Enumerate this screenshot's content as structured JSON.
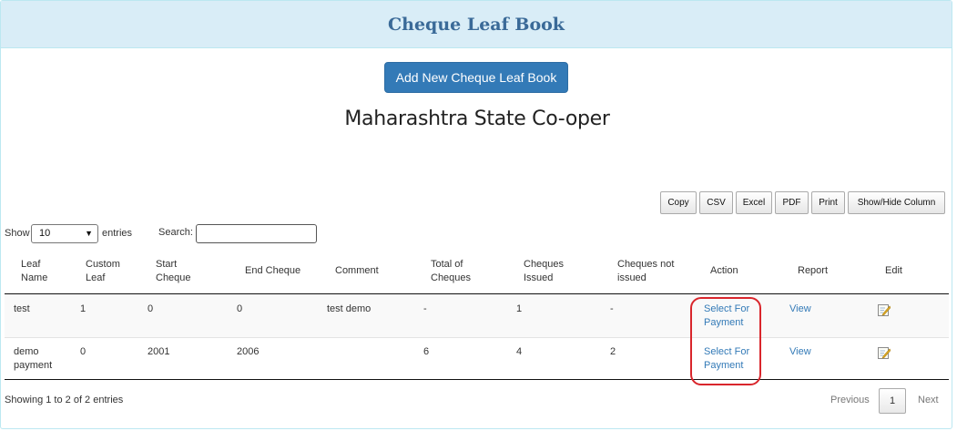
{
  "panel": {
    "title": "Cheque Leaf Book"
  },
  "add_button": {
    "label": "Add New Cheque Leaf Book"
  },
  "bank_name": "Maharashtra State Co-oper",
  "export_buttons": {
    "copy": "Copy",
    "csv": "CSV",
    "excel": "Excel",
    "pdf": "PDF",
    "print": "Print",
    "show_hide": "Show/Hide Column"
  },
  "length_control": {
    "show_label": "Show",
    "selected": "10",
    "entries_label": "entries"
  },
  "search": {
    "label": "Search:",
    "value": ""
  },
  "table": {
    "headers": {
      "leaf_name": [
        "Leaf",
        "Name"
      ],
      "custom_leaf": [
        "Custom",
        "Leaf"
      ],
      "start_cheque": [
        "Start",
        "Cheque"
      ],
      "end_cheque": "End Cheque",
      "comment": "Comment",
      "total_cheques": [
        "Total of",
        "Cheques"
      ],
      "cheques_issued": [
        "Cheques",
        "Issued"
      ],
      "cheques_not_issued": [
        "Cheques not",
        "issued"
      ],
      "action": "Action",
      "report": "Report",
      "edit": "Edit"
    },
    "rows": [
      {
        "leaf_name": [
          "test",
          ""
        ],
        "custom_leaf": "1",
        "start_cheque": "0",
        "end_cheque": "0",
        "comment": "test demo",
        "total_cheques": "-",
        "cheques_issued": "1",
        "cheques_not_issued": "-",
        "action": [
          "Select For",
          "Payment"
        ],
        "report": "View"
      },
      {
        "leaf_name": [
          "demo",
          "payment"
        ],
        "custom_leaf": "0",
        "start_cheque": "2001",
        "end_cheque": "2006",
        "comment": "",
        "total_cheques": "6",
        "cheques_issued": "4",
        "cheques_not_issued": "2",
        "action": [
          "Select For",
          "Payment"
        ],
        "report": "View"
      }
    ]
  },
  "footer": {
    "info": "Showing 1 to 2 of 2 entries",
    "previous": "Previous",
    "page": "1",
    "next": "Next"
  },
  "icons": {
    "edit": "edit-pencil-icon"
  },
  "colors": {
    "heading_bg": "#d9edf7",
    "primary": "#337ab7",
    "link": "#337ab7",
    "highlight": "#d9262c"
  }
}
